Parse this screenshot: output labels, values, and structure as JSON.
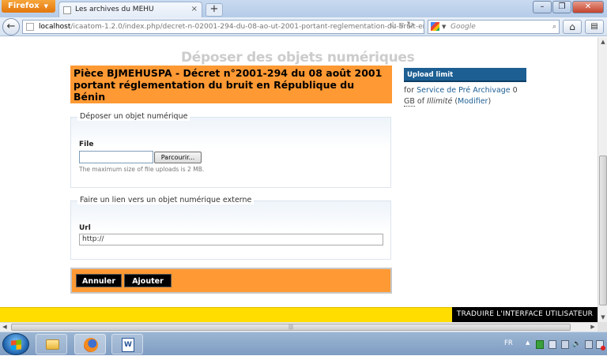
{
  "browser": {
    "firefox_label": "Firefox",
    "tab_title": "Les archives du MEHU",
    "new_tab_label": "+",
    "url_host": "localhost",
    "url_path": "/icaatom-1.2.0/index.php/decret-n-02001-294-du-08-ao-ut-2001-portant-reglementation-du-bruit-er",
    "search_placeholder": "Google"
  },
  "page": {
    "heading": "Déposer des objets numériques",
    "description_title": "Pièce BJMEHUSPA - Décret n°2001-294 du 08 août 2001 portant réglementation du bruit en République du Bénin",
    "upload_fieldset": {
      "legend": "Déposer un objet numérique",
      "file_label": "File",
      "browse_label": "Parcourir...",
      "help_text": "The maximum size of file uploads is 2 MB."
    },
    "link_fieldset": {
      "legend": "Faire un lien vers un objet numérique externe",
      "url_label": "Url",
      "url_value": "http://"
    },
    "actions": {
      "cancel_label": "Annuler",
      "add_label": "Ajouter"
    }
  },
  "sidebar": {
    "heading": "Upload limit",
    "for_text": "for",
    "service_link": "Service de Pré Archivage",
    "usage_value": "0",
    "unit": "GB",
    "of_text": "of",
    "limit_value": "Illimité",
    "modify_link": "Modifier"
  },
  "translate": {
    "label": "TRADUIRE L'INTERFACE UTILISATEUR"
  },
  "taskbar": {
    "lang": "FR",
    "word_icon_text": "W"
  }
}
